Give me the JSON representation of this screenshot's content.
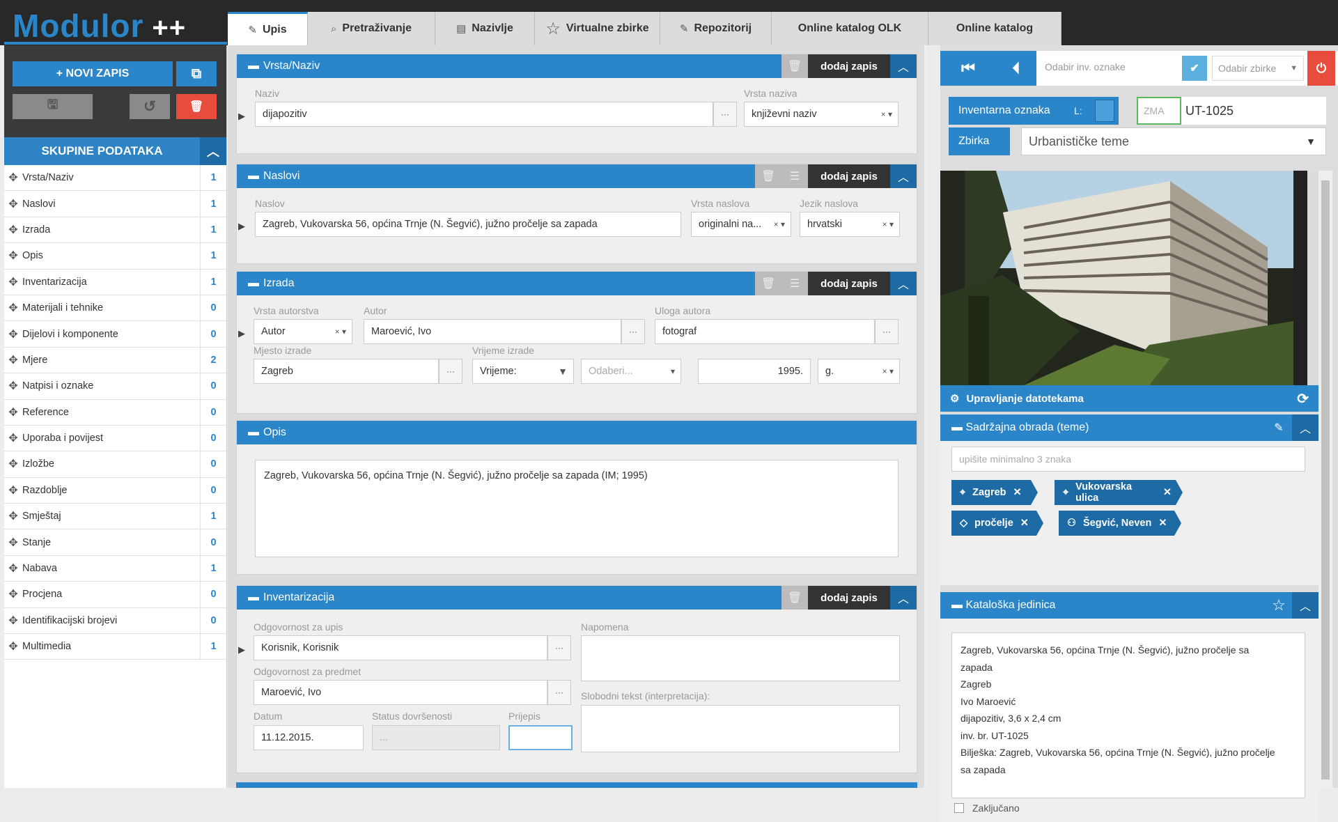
{
  "app": {
    "logo": "Modulor",
    "logo_suffix": "++"
  },
  "tabs": [
    {
      "label": "Upis",
      "icon": "edit-icon",
      "glyph": "✎"
    },
    {
      "label": "Pretraživanje",
      "icon": "search-icon",
      "glyph": "⌕"
    },
    {
      "label": "Nazivlje",
      "icon": "list-icon",
      "glyph": "▤"
    },
    {
      "label": "Virtualne zbirke",
      "icon": "star-outline-icon",
      "glyph": "☆"
    },
    {
      "label": "Repozitorij",
      "icon": "edit-icon",
      "glyph": "✎"
    },
    {
      "label": "Online katalog OLK",
      "icon": "",
      "glyph": ""
    },
    {
      "label": "Online katalog",
      "icon": "",
      "glyph": ""
    }
  ],
  "left": {
    "new_record": "+ NOVI ZAPIS",
    "section_title": "SKUPINE PODATAKA",
    "items": [
      {
        "label": "Vrsta/Naziv",
        "count": "1"
      },
      {
        "label": "Naslovi",
        "count": "1"
      },
      {
        "label": "Izrada",
        "count": "1"
      },
      {
        "label": "Opis",
        "count": "1"
      },
      {
        "label": "Inventarizacija",
        "count": "1"
      },
      {
        "label": "Materijali i tehnike",
        "count": "0"
      },
      {
        "label": "Dijelovi i komponente",
        "count": "0"
      },
      {
        "label": "Mjere",
        "count": "2"
      },
      {
        "label": "Natpisi i oznake",
        "count": "0"
      },
      {
        "label": "Reference",
        "count": "0"
      },
      {
        "label": "Uporaba i povijest",
        "count": "0"
      },
      {
        "label": "Izložbe",
        "count": "0"
      },
      {
        "label": "Razdoblje",
        "count": "0"
      },
      {
        "label": "Smještaj",
        "count": "1"
      },
      {
        "label": "Stanje",
        "count": "0"
      },
      {
        "label": "Nabava",
        "count": "1"
      },
      {
        "label": "Procjena",
        "count": "0"
      },
      {
        "label": "Identifikacijski brojevi",
        "count": "0"
      },
      {
        "label": "Multimedia",
        "count": "1"
      }
    ]
  },
  "common": {
    "add": "dodaj zapis"
  },
  "vrsta": {
    "title": "Vrsta/Naziv",
    "naziv_label": "Naziv",
    "naziv_value": "dijapozitiv",
    "vrsta_label": "Vrsta naziva",
    "vrsta_value": "književni naziv"
  },
  "naslovi": {
    "title": "Naslovi",
    "naslov_label": "Naslov",
    "naslov_value": "Zagreb, Vukovarska 56, općina Trnje (N. Šegvić), južno pročelje sa zapada",
    "vrsta_label": "Vrsta naslova",
    "vrsta_value": "originalni na...",
    "jezik_label": "Jezik naslova",
    "jezik_value": "hrvatski"
  },
  "izrada": {
    "title": "Izrada",
    "vrsta_aut_label": "Vrsta autorstva",
    "vrsta_aut_value": "Autor",
    "autor_label": "Autor",
    "autor_value": "Maroević, Ivo",
    "uloga_label": "Uloga autora",
    "uloga_value": "fotograf",
    "mjesto_label": "Mjesto izrade",
    "mjesto_value": "Zagreb",
    "vrijeme_label": "Vrijeme izrade",
    "vrijeme_value": "Vrijeme:",
    "odaberi": "Odaberi...",
    "godina": "1995.",
    "g": "g."
  },
  "opis": {
    "title": "Opis",
    "text": "Zagreb, Vukovarska 56, općina Trnje (N. Šegvić), južno pročelje sa zapada (IM; 1995)"
  },
  "inv": {
    "title": "Inventarizacija",
    "odg_upis_label": "Odgovornost za upis",
    "odg_upis_value": "Korisnik, Korisnik",
    "napomena_label": "Napomena",
    "odg_pred_label": "Odgovornost za predmet",
    "odg_pred_value": "Maroević, Ivo",
    "slobodni_label": "Slobodni tekst (interpretacija):",
    "datum_label": "Datum",
    "datum_value": "11.12.2015.",
    "status_label": "Status dovršenosti",
    "status_value": "...",
    "prijepis_label": "Prijepis"
  },
  "right": {
    "odabir_inv": "Odabir inv. oznake",
    "odabir_zbirke": "Odabir zbirke",
    "inv_label": "Inventarna oznaka",
    "inv_l": "L:",
    "zma_placeholder": "ZMA",
    "inv_value": "UT-1025",
    "zbirka_label": "Zbirka",
    "zbirka_value": "Urbanističke teme",
    "files_label": "Upravljanje datotekama",
    "sadrzajna_title": "Sadržajna obrada (teme)",
    "tag_placeholder": "upišite minimalno 3 znaka",
    "tags": [
      {
        "label": "Zagreb",
        "icon": "location-pin-icon"
      },
      {
        "label": "Vukovarska ulica",
        "icon": "location-pin-icon"
      },
      {
        "label": "pročelje",
        "icon": "tag-icon"
      },
      {
        "label": "Šegvić, Neven",
        "icon": "people-icon"
      }
    ],
    "kat_title": "Kataloška jedinica",
    "kat_lines": [
      "Zagreb, Vukovarska 56, općina Trnje (N. Šegvić), južno pročelje sa",
      "zapada",
      "Zagreb",
      "Ivo Maroević",
      "dijapozitiv, 3,6 x 2,4 cm",
      "inv. br. UT-1025",
      "Bilješka: Zagreb, Vukovarska 56, općina Trnje (N. Šegvić), južno pročelje",
      "sa zapada"
    ],
    "zakljucano": "Zaključano"
  },
  "colors": {
    "primary": "#2a86c8",
    "dark": "#282828",
    "danger": "#e74c3c"
  }
}
